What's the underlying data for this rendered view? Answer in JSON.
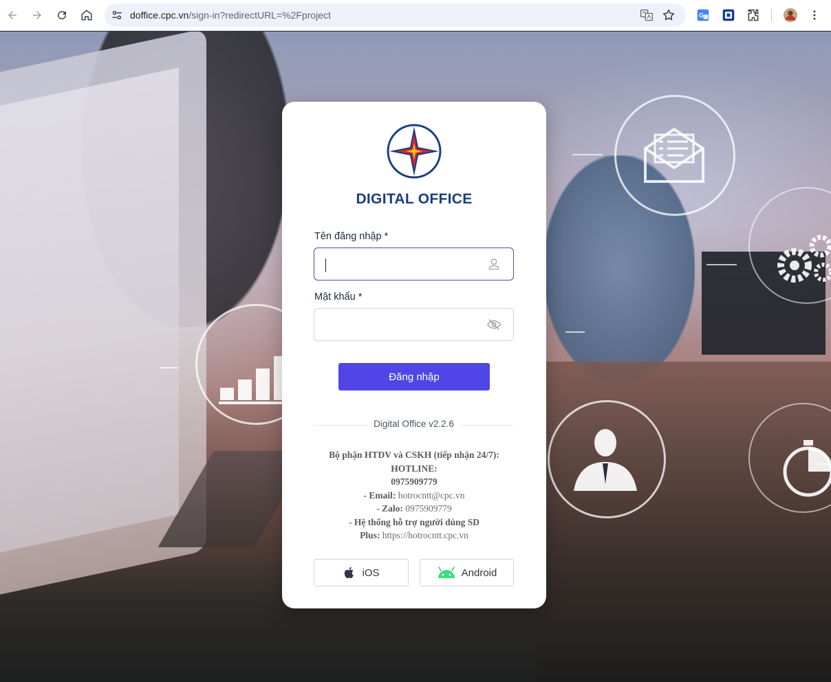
{
  "browser": {
    "url_host": "doffice.cpc.vn",
    "url_path": "/sign-in?redirectURL=%2Fproject",
    "icons": [
      "back-icon",
      "forward-icon",
      "reload-icon",
      "home-icon",
      "site-settings-icon",
      "translate-icon",
      "bookmark-star-icon",
      "extension-translate-icon",
      "extension-screenshot-icon",
      "extensions-puzzle-icon",
      "profile-avatar",
      "menu-kebab-icon"
    ]
  },
  "login": {
    "brand": "DIGITAL OFFICE",
    "username_label": "Tên đăng nhập",
    "password_label": "Mật khẩu",
    "required_mark": "*",
    "username_value": "",
    "password_value": "",
    "submit_label": "Đăng nhập",
    "version": "Digital Office v2.2.6"
  },
  "support": {
    "dept": "Bộ phận HTDV và CSKH (tiếp nhận 24/7):",
    "hotline_label": "HOTLINE:",
    "hotline_number": "0975909779",
    "email_label": "- Email:",
    "email_value": "hotrocntt@cpc.vn",
    "zalo_label": "- Zalo:",
    "zalo_value": "0975909779",
    "system_label": "- Hệ thống hỗ trợ người dùng SD",
    "plus_label": "Plus:",
    "plus_value": "https://hotrocntt.cpc.vn"
  },
  "apps": {
    "ios_label": "iOS",
    "android_label": "Android"
  },
  "colors": {
    "brand": "#1b3d7f",
    "primary_button": "#4f46e5",
    "focus_border": "#4f46b5",
    "android_green": "#3ddc84"
  }
}
